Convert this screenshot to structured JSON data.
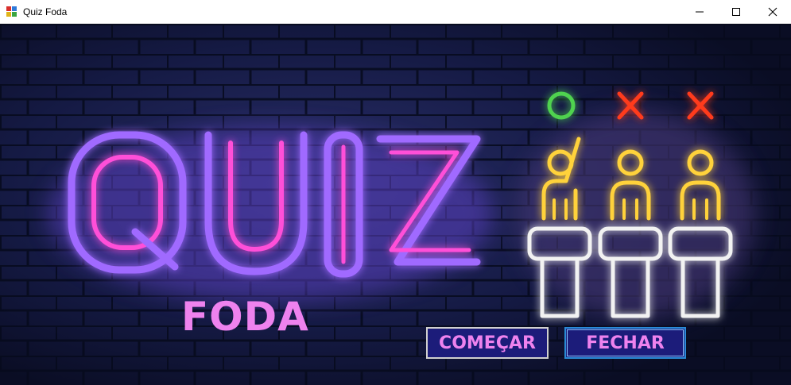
{
  "window": {
    "title": "Quiz Foda",
    "icon": "app-form-icon",
    "controls": [
      "minimize-icon",
      "maximize-icon",
      "close-icon"
    ]
  },
  "banner": {
    "title": "QUIZ",
    "subtitle": "FODA",
    "icon": "quiz-contestants-icon"
  },
  "buttons": {
    "start_label": "COMEÇAR",
    "close_label": "FECHAR"
  },
  "colors": {
    "accent": "#ee82ee",
    "button_bg": "#1c1c7a",
    "wall_bg": "#0d1230",
    "neon_pink": "#ff4fd8",
    "neon_purple": "#a06bff",
    "neon_green": "#4fd24f",
    "neon_red": "#ff3b1f",
    "neon_yellow": "#ffd23a"
  }
}
